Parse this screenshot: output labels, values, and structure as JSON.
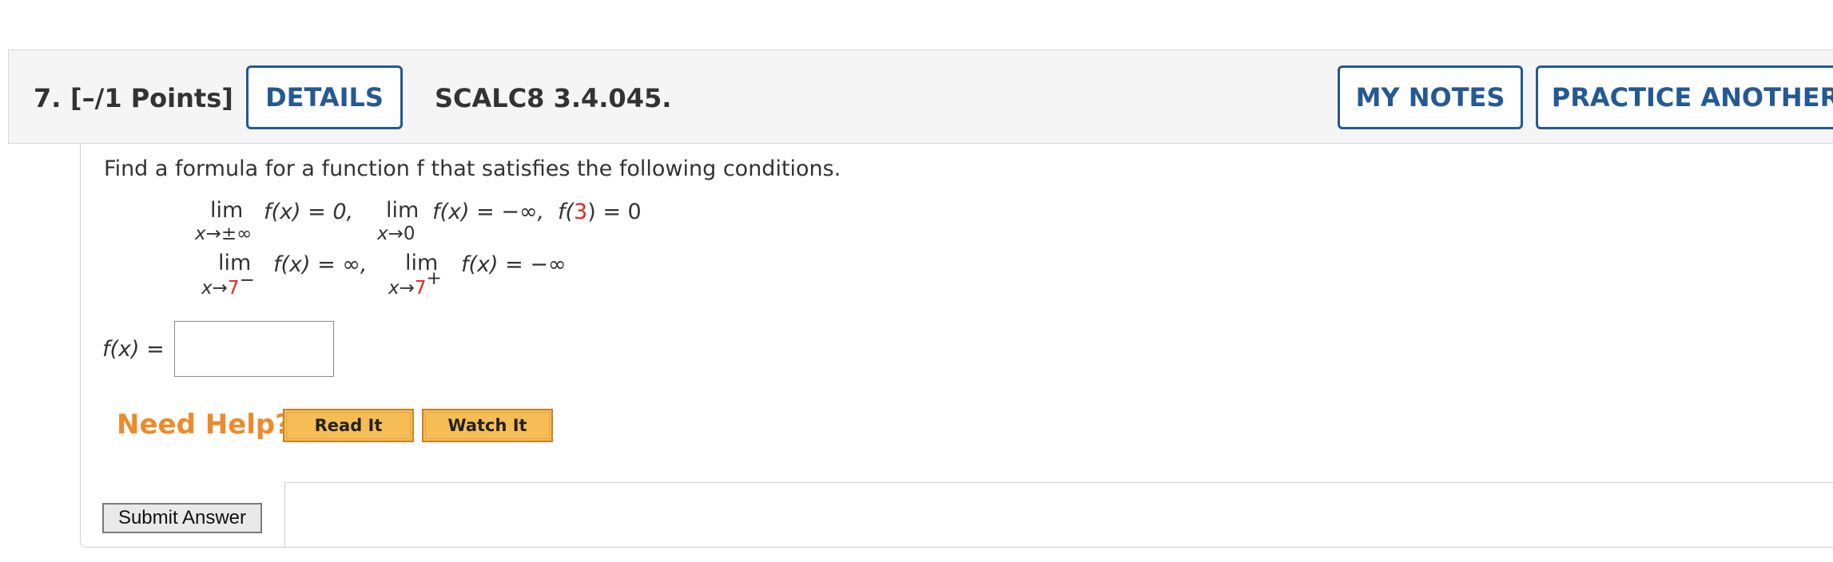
{
  "header": {
    "question_number": "7.",
    "points": "[–/1 Points]",
    "details_label": "DETAILS",
    "problem_code": "SCALC8 3.4.045.",
    "my_notes_label": "MY NOTES",
    "practice_label": "PRACTICE ANOTHER"
  },
  "problem": {
    "instructions": "Find a formula for a function f that satisfies the following conditions.",
    "conditions": {
      "lim": "lim",
      "c1_expr": "f(x) = 0,",
      "c1_sub_var": "x",
      "c1_sub_arrow": "→",
      "c1_sub_to": "±∞",
      "c2_expr": "f(x) = −∞,",
      "c2_sub_var": "x",
      "c2_sub_arrow": "→",
      "c2_sub_to": "0",
      "c3_prefix": "f(",
      "c3_value": "3",
      "c3_suffix": ") = 0",
      "c4_expr": "f(x) = ∞,",
      "c4_sub_var": "x",
      "c4_sub_arrow": "→",
      "c4_sub_to": "7",
      "c4_side": "−",
      "c5_expr": "f(x) = −∞",
      "c5_sub_var": "x",
      "c5_sub_arrow": "→",
      "c5_sub_to": "7",
      "c5_side": "+"
    },
    "answer_label": "f(x) =",
    "answer_value": ""
  },
  "help": {
    "need_help": "Need Help?",
    "read_it": "Read It",
    "watch_it": "Watch It"
  },
  "submit": {
    "label": "Submit Answer"
  },
  "colors": {
    "accent": "#245993",
    "help_orange": "#ee8a2c",
    "button_gold": "#f7bd55",
    "highlight_red": "#e0261d"
  }
}
